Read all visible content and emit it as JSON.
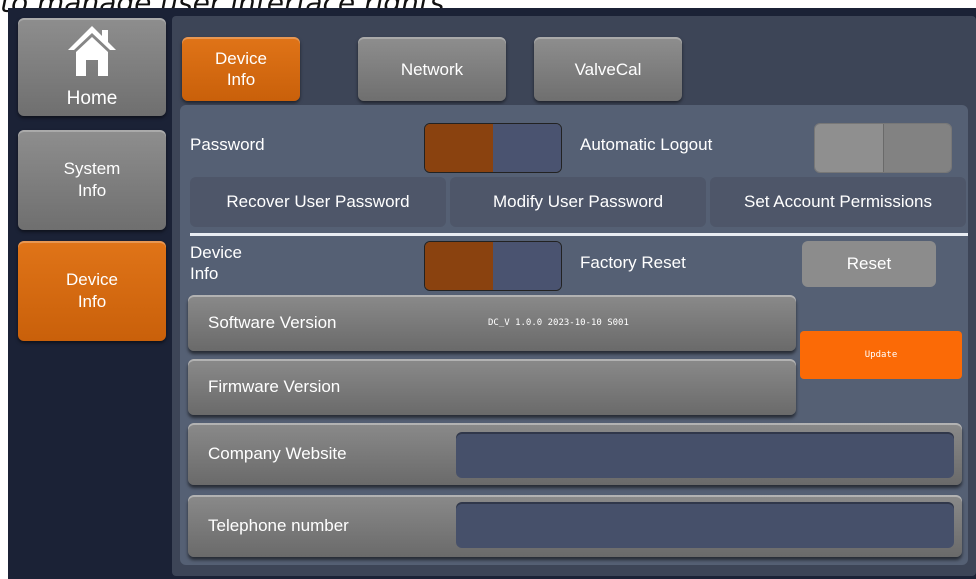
{
  "caption": "to manage user interface rights.",
  "nav": {
    "home_label": "Home",
    "system_info_label": "System\nInfo",
    "device_info_label": "Device\nInfo"
  },
  "tabs": {
    "device_info": "Device\nInfo",
    "network": "Network",
    "valvecal": "ValveCal"
  },
  "security": {
    "password_label": "Password",
    "automatic_logout_label": "Automatic Logout",
    "recover_button": "Recover User Password",
    "modify_button": "Modify User Password",
    "permissions_button": "Set Account Permissions"
  },
  "device": {
    "device_info_label": "Device\nInfo",
    "factory_reset_label": "Factory Reset",
    "reset_button": "Reset",
    "software_version_label": "Software Version",
    "software_version_value": "DC_V 1.0.0 2023-10-10 S001",
    "update_button": "Update",
    "firmware_version_label": "Firmware Version",
    "company_website_label": "Company Website",
    "company_website_value": "",
    "telephone_label": "Telephone number",
    "telephone_value": ""
  },
  "colors": {
    "accent": "#d4670f",
    "toggle_on": "#8a420f",
    "toggle_off": "#4a5370",
    "background": "#1b2236"
  }
}
